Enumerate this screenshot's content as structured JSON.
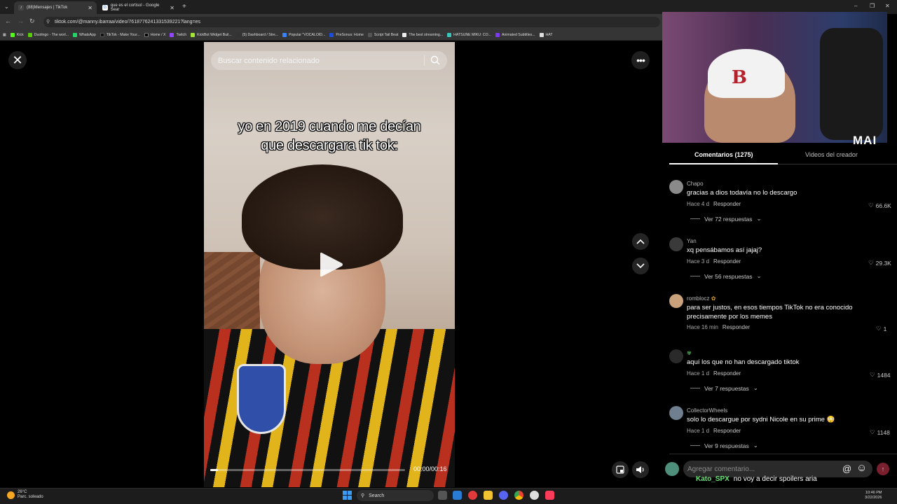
{
  "browser": {
    "tabs": [
      {
        "title": "(88)Mensajes | TikTok",
        "active": true
      },
      {
        "title": "que es el cortisol - Google Sear",
        "active": false
      }
    ],
    "new_tab": "+",
    "url": "tiktok.com/@manny.ibarraa/video/761877624133153922​1?lang=es",
    "bookmarks": [
      "Kick",
      "Duolingo - The worl...",
      "WhatsApp",
      "TikTok - Make Your...",
      "Home / X",
      "Twitch",
      "KickBot Widget Buil...",
      "(5) Dashboard / Stre...",
      "Popular \"VOCALOID...",
      "PreSonus: Home",
      "Script Tail Beat",
      "The best streaming...",
      "HATSUNE MIKU: CO...",
      "Animated Subtitles...",
      "HAT"
    ]
  },
  "player": {
    "search_placeholder": "Buscar contenido relacionado",
    "overlay_text": "yo en 2019 cuando me decían que descargara tik tok:",
    "time": "00:00/00:16",
    "progress": 0.04,
    "close_glyph": "✕",
    "more_glyph": "•••"
  },
  "webcam": {
    "brand": "MAI",
    "cap_logo": "B"
  },
  "comments_panel": {
    "tab_comments": "Comentarios (1275)",
    "tab_creator": "Videos del creador",
    "reply_label": "Responder",
    "comments": [
      {
        "user": "Chapo",
        "text": "gracias a dios todavía no lo descargo",
        "time": "Hace 4 d",
        "likes": "66.6K",
        "more": "Ver 72 respuestas",
        "avatar_color": "#8a8a8a"
      },
      {
        "user": "Yan",
        "text": "xq pensábamos así jajaj?",
        "time": "Hace 3 d",
        "likes": "29.3K",
        "more": "Ver 56 respuestas",
        "avatar_color": "#3a3a3a"
      },
      {
        "user": "romblocz",
        "text": "para ser justos, en esos tiempos TikTok no era conocido precisamente por los memes",
        "time": "Hace 16 min",
        "likes": "1",
        "more": "",
        "avatar_color": "#c9a27c"
      },
      {
        "user": "",
        "text": "aquí los que no han descargado tiktok",
        "time": "Hace 1 d",
        "likes": "1484",
        "more": "Ver 7 respuestas",
        "avatar_color": "#2a2a2a"
      },
      {
        "user": "CollectorWheels",
        "text": "solo lo descargue por sydni Nicole en su prime 😳",
        "time": "Hace 1 d",
        "likes": "1148",
        "more": "Ver 9 respuestas",
        "avatar_color": "#6f7f8f"
      }
    ],
    "comment_placeholder": "Agregar comentario...",
    "at_glyph": "@",
    "emoji_glyph": "☺",
    "send_glyph": "↑"
  },
  "chat_overlay": {
    "user": "Kato_SPX",
    "text": "no voy a decir spoilers aria"
  },
  "taskbar": {
    "weather_temp": "26°C",
    "weather_desc": "Parc. soleado",
    "search_label": "Search",
    "time": "10:46 PM",
    "date": "3/22/2026"
  },
  "colors": {
    "accent": "#fe2c55",
    "send_bg": "#7a1f2e",
    "chat_user": "#6fe07a"
  }
}
